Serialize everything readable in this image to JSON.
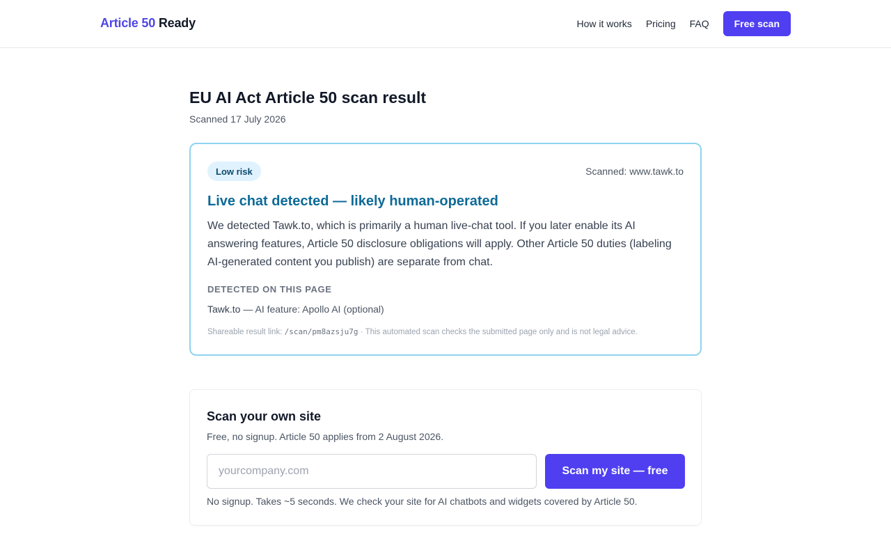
{
  "header": {
    "logo_accent": "Article 50",
    "logo_rest": "Ready",
    "nav": [
      "How it works",
      "Pricing",
      "FAQ"
    ],
    "cta_label": "Free scan"
  },
  "page": {
    "title": "EU AI Act Article 50 scan result",
    "scan_date": "Scanned 17 July 2026"
  },
  "result": {
    "risk_label": "Low risk",
    "scanned_host": "Scanned: www.tawk.to",
    "title": "Live chat detected — likely human-operated",
    "body": "We detected Tawk.to, which is primarily a human live-chat tool. If you later enable its AI answering features, Article 50 disclosure obligations will apply. Other Article 50 duties (labeling AI-generated content you publish) are separate from chat.",
    "detected_heading": "DETECTED ON THIS PAGE",
    "detected_vendor": "Tawk.to",
    "detected_feature": " — AI feature: Apollo AI (optional)",
    "share_prefix": "Shareable result link: ",
    "share_path": "/scan/pm8azsju7g",
    "share_suffix": " · This automated scan checks the submitted page only and is not legal advice."
  },
  "scan_form": {
    "title": "Scan your own site",
    "subtitle": "Free, no signup. Article 50 applies from 2 August 2026.",
    "placeholder": "yourcompany.com",
    "button_label": "Scan my site — free",
    "note": "No signup. Takes ~5 seconds. We check your site for AI chatbots and widgets covered by Article 50."
  },
  "colors": {
    "brand": "#4f3ff0",
    "result_title": "#0e6a98",
    "card_border": "#8fd3ee",
    "badge_bg": "#e0f2fe"
  }
}
